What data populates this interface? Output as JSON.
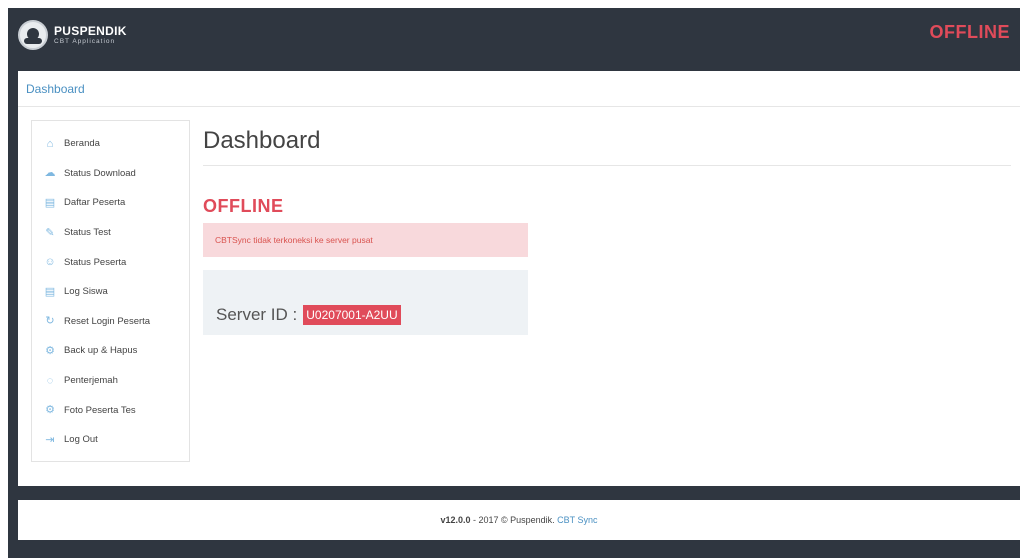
{
  "navbar": {
    "brand_title": "PUSPENDIK",
    "brand_subtitle": "CBT Application",
    "status": "OFFLINE"
  },
  "breadcrumb": {
    "label": "Dashboard"
  },
  "sidebar": {
    "items": [
      {
        "label": "Beranda",
        "icon": "home-icon",
        "glyph": "⌂"
      },
      {
        "label": "Status Download",
        "icon": "cloud-download-icon",
        "glyph": "☁"
      },
      {
        "label": "Daftar Peserta",
        "icon": "folder-icon",
        "glyph": "▤"
      },
      {
        "label": "Status Test",
        "icon": "edit-icon",
        "glyph": "✎"
      },
      {
        "label": "Status Peserta",
        "icon": "users-icon",
        "glyph": "☺"
      },
      {
        "label": "Log Siswa",
        "icon": "folder-icon",
        "glyph": "▤"
      },
      {
        "label": "Reset Login Peserta",
        "icon": "refresh-icon",
        "glyph": "↻"
      },
      {
        "label": "Back up & Hapus",
        "icon": "gear-icon",
        "glyph": "⚙"
      },
      {
        "label": "Penterjemah",
        "icon": "chat-icon",
        "glyph": "◌"
      },
      {
        "label": "Foto Peserta Tes",
        "icon": "gear-icon",
        "glyph": "⚙"
      },
      {
        "label": "Log Out",
        "icon": "logout-icon",
        "glyph": "⇥"
      }
    ]
  },
  "main": {
    "title": "Dashboard",
    "status_heading": "OFFLINE",
    "alert_text": "CBTSync tidak terkoneksi ke server pusat",
    "server_label": "Server ID :",
    "server_id": "U0207001-A2UU"
  },
  "footer": {
    "version": "v12.0.0",
    "text": " - 2017 © Puspendik. ",
    "link": "CBT Sync"
  },
  "colors": {
    "frame": "#2f3640",
    "accent_red": "#e04b5a",
    "link_blue": "#4a90c2",
    "icon_blue": "#7fb8e0"
  }
}
